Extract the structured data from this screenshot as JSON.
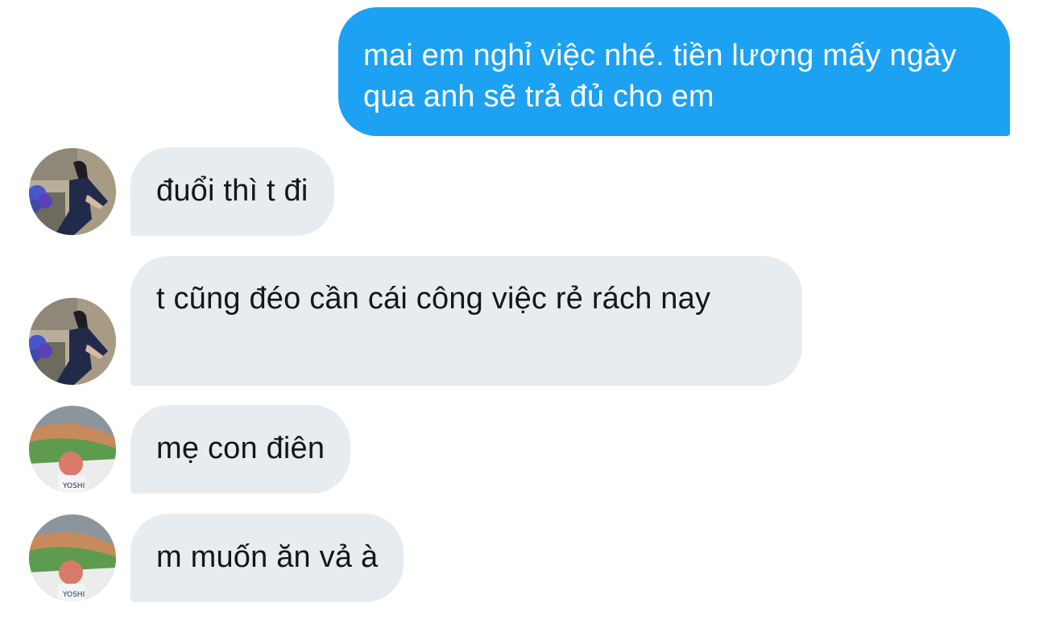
{
  "conversation": {
    "sent_message": "mai em nghỉ việc nhé. tiền lương mấy ngày qua anh sẽ trả đủ cho em",
    "received": [
      {
        "text": "đuổi thì t đi",
        "avatar": "woman-in-navy-dress-photo"
      },
      {
        "text": "t cũng đéo cần cái công việc rẻ rách nay",
        "avatar": "woman-in-navy-dress-photo"
      },
      {
        "text": "mẹ con điên",
        "avatar": "stadium-fan-photo"
      },
      {
        "text": "m muốn ăn vả à",
        "avatar": "stadium-fan-photo"
      }
    ],
    "avatar_jersey_text": "YOSHI"
  },
  "colors": {
    "sent_bubble": "#1da1f2",
    "received_bubble": "#e6ecf0",
    "received_text": "#14171a",
    "background": "#ffffff"
  }
}
